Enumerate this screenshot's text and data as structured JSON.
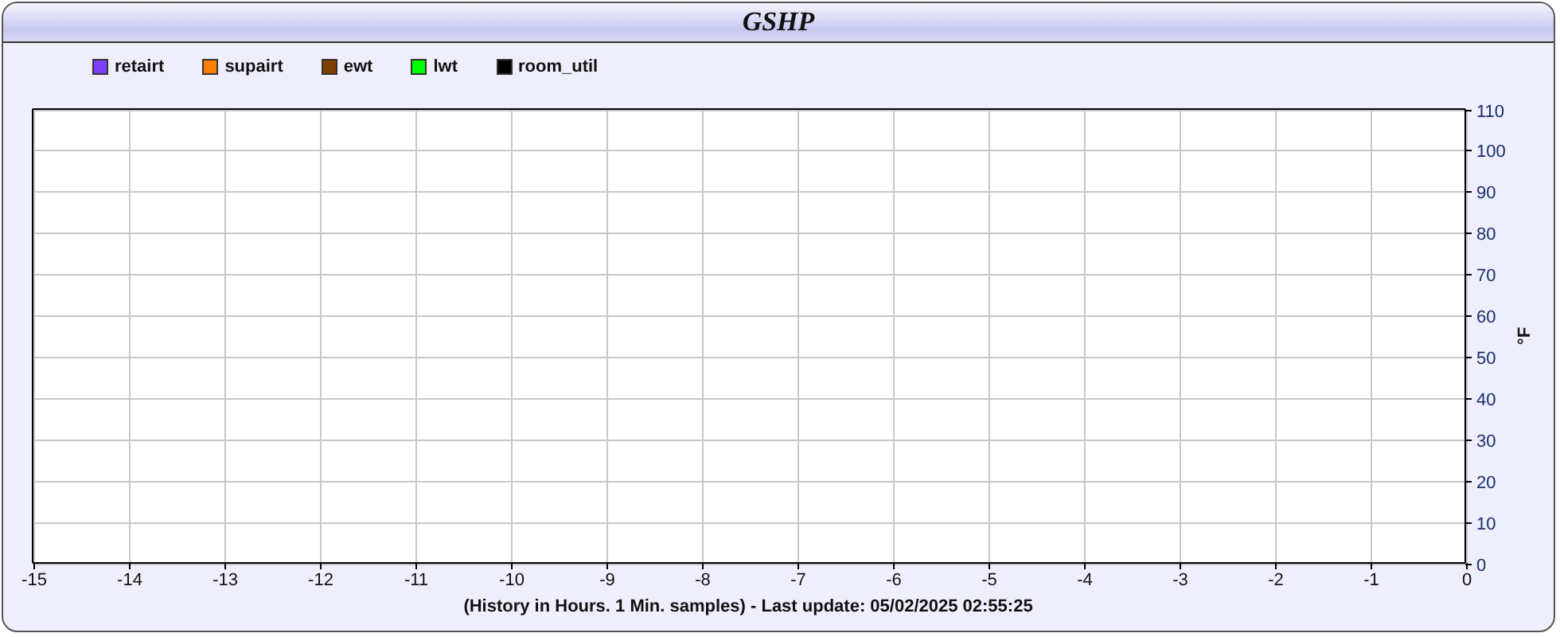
{
  "window": {
    "title": "GSHP"
  },
  "chart": {
    "chart_data": {
      "type": "line",
      "xlabel": "(History in Hours. 1 Min. samples) - Last update: 05/02/2025 02:55:25",
      "ylabel": "°F",
      "grid": true,
      "ylim": [
        0,
        110
      ],
      "categories": [
        "-15",
        "-14",
        "-13",
        "-12",
        "-11",
        "-10",
        "-9",
        "-8",
        "-7",
        "-6",
        "-5",
        "-4",
        "-3",
        "-2",
        "-1",
        "0"
      ],
      "yticks": [
        0,
        10,
        20,
        30,
        40,
        50,
        60,
        70,
        80,
        90,
        100,
        110
      ],
      "series": [
        {
          "name": "retairt",
          "color": "#7f3fff",
          "values": [
            null,
            null,
            null,
            null,
            null,
            null,
            null,
            null,
            null,
            null,
            null,
            null,
            null,
            null,
            null,
            null
          ]
        },
        {
          "name": "supairt",
          "color": "#ff8000",
          "values": [
            null,
            null,
            null,
            null,
            null,
            null,
            null,
            null,
            null,
            null,
            null,
            null,
            null,
            null,
            null,
            null
          ]
        },
        {
          "name": "ewt",
          "color": "#7f3f00",
          "values": [
            null,
            null,
            null,
            null,
            null,
            null,
            null,
            null,
            null,
            null,
            null,
            null,
            null,
            null,
            null,
            null
          ]
        },
        {
          "name": "lwt",
          "color": "#00ff00",
          "values": [
            null,
            null,
            null,
            null,
            null,
            null,
            null,
            null,
            null,
            null,
            null,
            null,
            null,
            null,
            null,
            null
          ]
        },
        {
          "name": "room_util",
          "color": "#000000",
          "values": [
            null,
            null,
            null,
            null,
            null,
            null,
            null,
            null,
            null,
            null,
            null,
            null,
            null,
            null,
            null,
            null
          ]
        }
      ]
    }
  }
}
